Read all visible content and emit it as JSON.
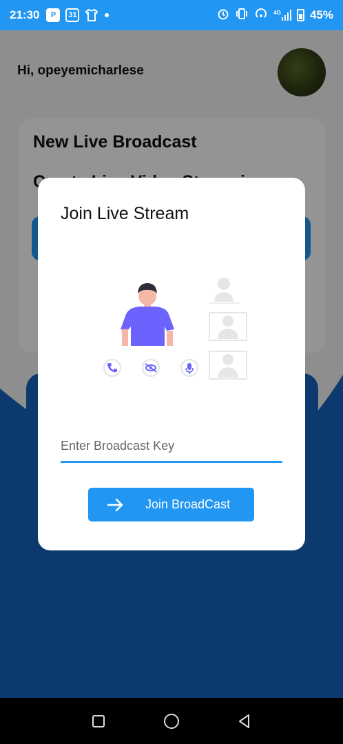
{
  "status_bar": {
    "time": "21:30",
    "calendar_day": "31",
    "network": "4G",
    "battery": "45%",
    "left_icons": [
      "parking-icon",
      "calendar-icon",
      "shirt-icon",
      "dot-icon"
    ],
    "right_icons": [
      "alarm-icon",
      "vibrate-icon",
      "hotspot-icon",
      "signal-icon",
      "battery-icon"
    ]
  },
  "app": {
    "greeting": "Hi, opeyemicharlese",
    "card": {
      "title": "New Live Broadcast",
      "subtitle": "Create Live Video Streaming"
    }
  },
  "dialog": {
    "title": "Join Live Stream",
    "input_placeholder": "Enter Broadcast Key",
    "input_value": "",
    "join_label": "Join BroadCast",
    "illustration_icons": [
      "phone-icon",
      "eye-off-icon",
      "mic-icon"
    ]
  },
  "nav_bar": [
    "recent-apps-icon",
    "home-icon",
    "back-icon"
  ],
  "colors": {
    "primary": "#2196f3",
    "dark_blue": "#0d2b5c",
    "accent_purple": "#6c63ff"
  }
}
